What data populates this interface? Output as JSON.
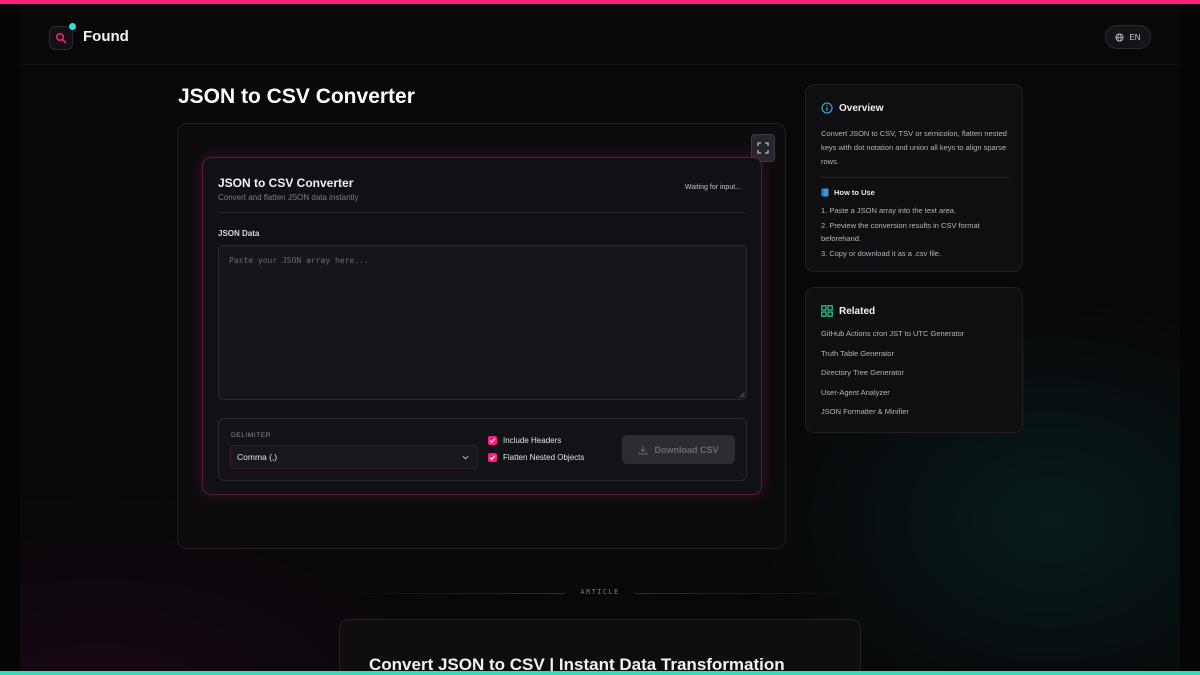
{
  "header": {
    "brand": "Found",
    "lang": "EN"
  },
  "page": {
    "title": "JSON to CSV Converter"
  },
  "tool": {
    "title": "JSON to CSV Converter",
    "subtitle": "Convert and flatten JSON data instantly",
    "status": "Waiting for input...",
    "json_label": "JSON Data",
    "json_value": "",
    "json_placeholder": "Paste your JSON array here...",
    "delimiter_label": "DELIMITER",
    "delimiter_selected": "Comma (,)",
    "include_headers": {
      "label": "Include Headers",
      "checked": true
    },
    "flatten_nested": {
      "label": "Flatten Nested Objects",
      "checked": true
    },
    "download_label": "Download CSV"
  },
  "sidebar": {
    "overview": {
      "title": "Overview",
      "text": "Convert JSON to CSV, TSV or semicolon, flatten nested keys with dot notation and union all keys to align sparse rows.",
      "howto_title": "How to Use",
      "steps": [
        "1. Paste a JSON array into the text area.",
        "2. Preview the conversion results in CSV format beforehand.",
        "3. Copy or download it as a .csv file."
      ]
    },
    "related": {
      "title": "Related",
      "links": [
        "GitHub Actions cron JST to UTC Generator",
        "Truth Table Generator",
        "Directory Tree Generator",
        "User-Agent Analyzer",
        "JSON Formatter & Minifier"
      ]
    }
  },
  "article": {
    "label": "ARTICLE",
    "title": "Convert JSON to CSV | Instant Data Transformation"
  },
  "colors": {
    "accent": "#ff1f7a",
    "accent2": "#2de0b5",
    "background": "#08080a"
  },
  "icons": {
    "logo": "search-icon",
    "lang": "globe-icon",
    "fullscreen": "expand-icon",
    "overview": "info-icon",
    "howto": "book-icon",
    "related": "grid-icon",
    "download": "download-icon"
  }
}
